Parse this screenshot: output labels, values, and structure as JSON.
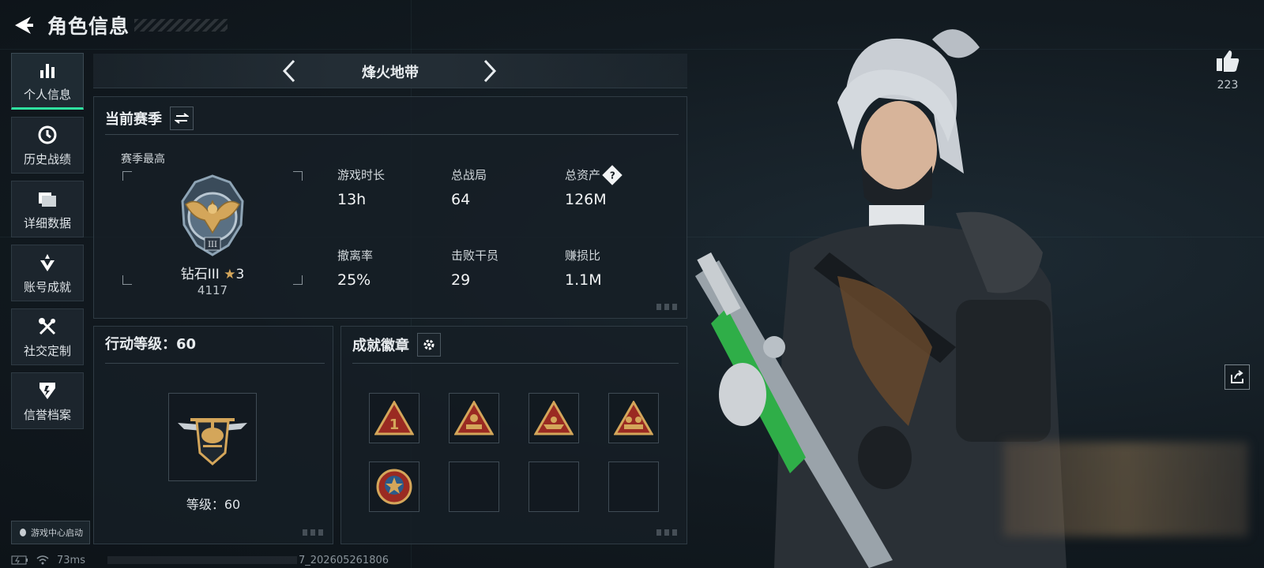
{
  "header": {
    "title": "角色信息"
  },
  "sidebar": {
    "items": [
      {
        "label": "个人信息",
        "icon": "bar-chart-icon",
        "active": true
      },
      {
        "label": "历史战绩",
        "icon": "history-clock-icon"
      },
      {
        "label": "详细数据",
        "icon": "folder-icon"
      },
      {
        "label": "账号成就",
        "icon": "achievement-icon"
      },
      {
        "label": "社交定制",
        "icon": "tools-icon"
      },
      {
        "label": "信誉档案",
        "icon": "credit-shield-icon"
      }
    ],
    "launch_label": "游戏中心启动"
  },
  "status_bar": {
    "latency": "73ms",
    "build_suffix": "7_202605261806"
  },
  "mode": {
    "title": "烽火地带"
  },
  "season": {
    "title": "当前赛季",
    "best_label": "赛季最高",
    "rank_name": "钻石III",
    "rank_stars": "3",
    "rank_score": "4117",
    "stats": [
      {
        "label": "游戏时长",
        "value": "13h"
      },
      {
        "label": "总战局",
        "value": "64"
      },
      {
        "label": "总资产",
        "value": "126M",
        "help": "?"
      },
      {
        "label": "撤离率",
        "value": "25%"
      },
      {
        "label": "击败干员",
        "value": "29"
      },
      {
        "label": "赚损比",
        "value": "1.1M"
      }
    ]
  },
  "level": {
    "title": "行动等级：60",
    "text": "等级：60"
  },
  "badges": {
    "title": "成就徽章",
    "slots": 8,
    "filled": 5
  },
  "like": {
    "count": "223"
  },
  "colors": {
    "accent": "#2fe1a0",
    "gold": "#d4a65a",
    "badge_red": "#9a2a22"
  }
}
